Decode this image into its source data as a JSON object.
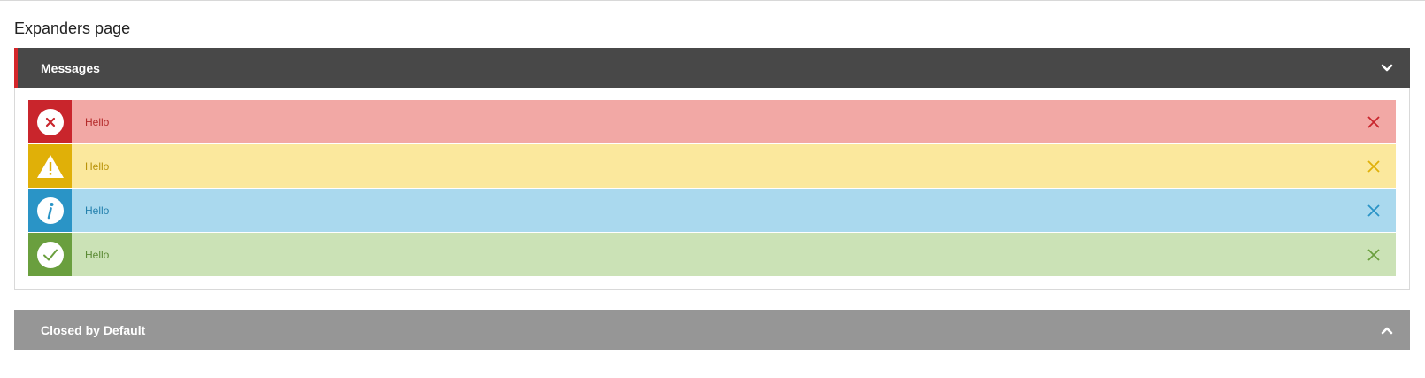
{
  "page": {
    "title": "Expanders page"
  },
  "expanders": [
    {
      "label": "Messages",
      "state": "open",
      "messages": [
        {
          "type": "error",
          "icon": "error-icon",
          "text": "Hello",
          "icon_bg": "#c9252c",
          "bg": "#f2a8a5",
          "fg": "#b42a2a"
        },
        {
          "type": "warning",
          "icon": "warning-icon",
          "text": "Hello",
          "icon_bg": "#e0b008",
          "bg": "#fbe89d",
          "fg": "#b9930a"
        },
        {
          "type": "info",
          "icon": "info-icon",
          "text": "Hello",
          "icon_bg": "#2a94c6",
          "bg": "#aad9ee",
          "fg": "#2480ad"
        },
        {
          "type": "success",
          "icon": "success-icon",
          "text": "Hello",
          "icon_bg": "#6a9f3e",
          "bg": "#cbe2b6",
          "fg": "#5b8a34"
        }
      ]
    },
    {
      "label": "Closed by Default",
      "state": "closed"
    }
  ],
  "colors": {
    "open_header": "#484848",
    "closed_header": "#969696",
    "accent": "#d4262a"
  }
}
